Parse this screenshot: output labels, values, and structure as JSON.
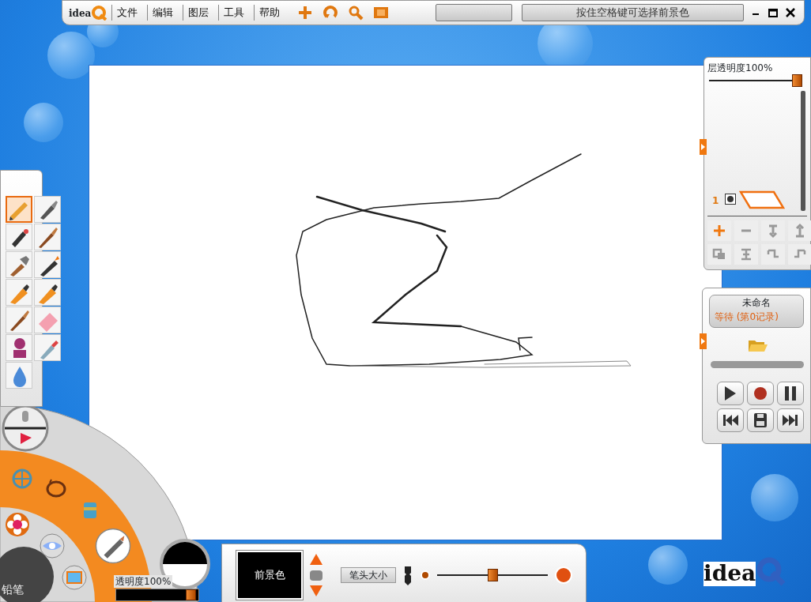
{
  "logo": {
    "text": "idea"
  },
  "menu": [
    {
      "label": "文件"
    },
    {
      "label": "编辑"
    },
    {
      "label": "图层"
    },
    {
      "label": "工具"
    },
    {
      "label": "帮助"
    }
  ],
  "toolbar": [
    {
      "kind": "move"
    },
    {
      "kind": "rotate"
    },
    {
      "kind": "zoom"
    },
    {
      "kind": "frame"
    }
  ],
  "hint": "按住空格键可选择前景色",
  "layers_panel": {
    "opacity_label": "层透明度100%",
    "opacity": {
      "level": 1.0
    },
    "layers": [
      {
        "number": "1",
        "visible": true
      }
    ],
    "actions": [
      {
        "kind": "add",
        "enabled": true
      },
      {
        "kind": "remove",
        "enabled": false
      },
      {
        "kind": "down",
        "enabled": false
      },
      {
        "kind": "up",
        "enabled": false
      },
      {
        "kind": "copy",
        "enabled": false
      },
      {
        "kind": "merge",
        "enabled": false
      },
      {
        "kind": "left",
        "enabled": false
      },
      {
        "kind": "right",
        "enabled": false
      }
    ]
  },
  "record_panel": {
    "title": "未命名",
    "status": "等待 (第0记录)"
  },
  "tools": [
    {
      "kind": "pencil",
      "selected": true
    },
    {
      "kind": "pen",
      "selected": false
    },
    {
      "kind": "airbrush",
      "selected": false
    },
    {
      "kind": "brush",
      "selected": false
    },
    {
      "kind": "flat",
      "selected": false
    },
    {
      "kind": "crayon",
      "selected": false
    },
    {
      "kind": "marker",
      "selected": false
    },
    {
      "kind": "marker",
      "selected": false
    },
    {
      "kind": "brush",
      "selected": false
    },
    {
      "kind": "eraser",
      "selected": false
    },
    {
      "kind": "stamp",
      "selected": false
    },
    {
      "kind": "dropper",
      "selected": false
    },
    {
      "kind": "drop",
      "selected": false
    }
  ],
  "wheel": {
    "current_tool": "铅笔"
  },
  "color_panel": {
    "opacity_label": "透明度100%",
    "opacity": {
      "level": 0.97
    }
  },
  "bottom_bar": {
    "foreground_label": "前景色",
    "size_label": "笔头大小",
    "size": {
      "level": 0.5
    }
  },
  "brand": {
    "text": "idea"
  }
}
